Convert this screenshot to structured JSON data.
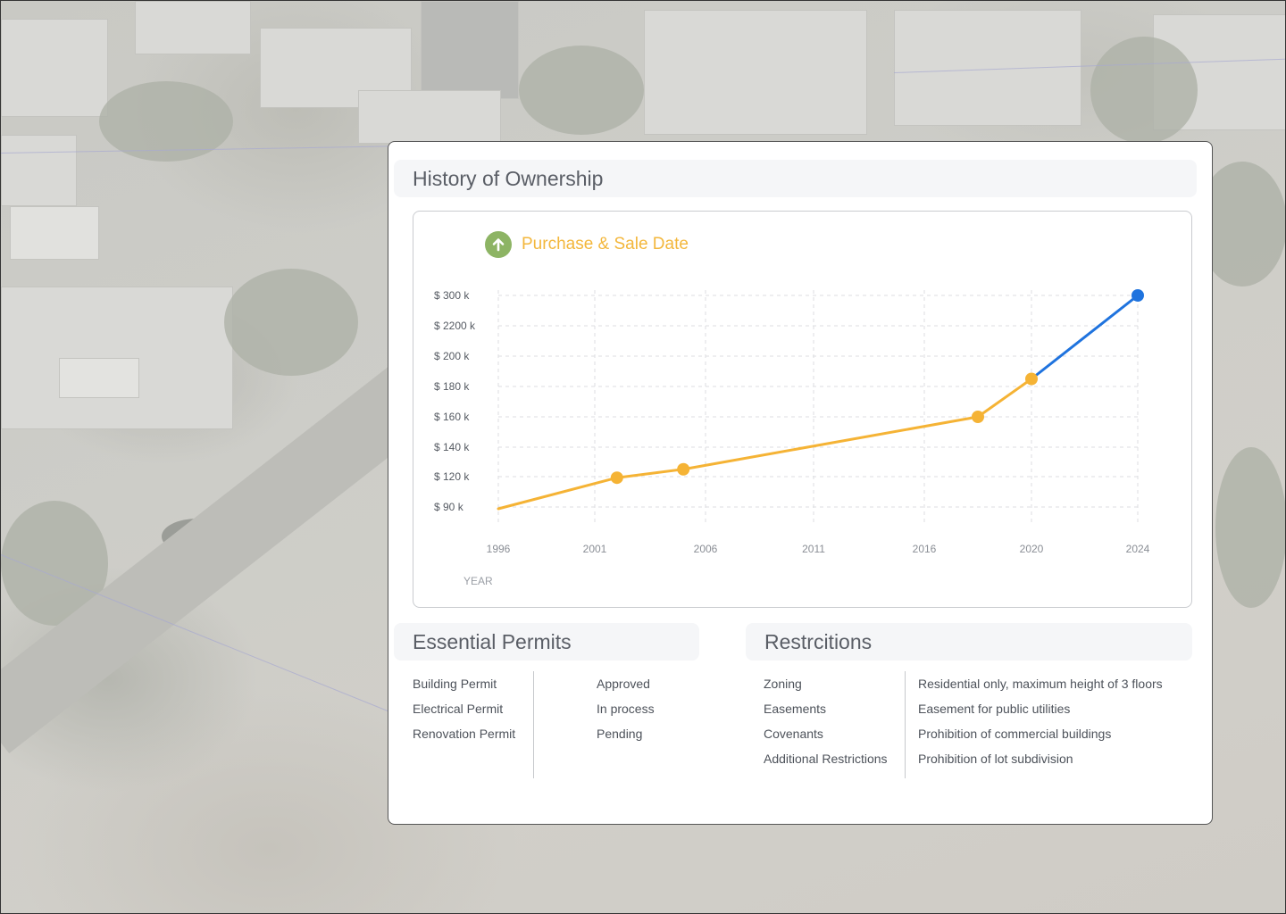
{
  "ownership": {
    "title": "History of Ownership"
  },
  "chart": {
    "icon": "arrow-up-circle-icon",
    "title": "Purchase & Sale Date",
    "colors": {
      "history": "#f5b335",
      "projection": "#1f73de",
      "icon_bg": "#8db464",
      "title": "#f3b73c"
    }
  },
  "chart_data": {
    "type": "line",
    "title": "Purchase & Sale Date",
    "xlabel": "YEAR",
    "ylabel": "",
    "x_ticks": [
      "1996",
      "2001",
      "2006",
      "2011",
      "2016",
      "2020",
      "2024"
    ],
    "y_ticks": [
      "$ 300 k",
      "$ 2200 k",
      "$ 200 k",
      "$ 180 k",
      "$ 160 k",
      "$ 140 k",
      "$ 120 k",
      "$ 90 k"
    ],
    "grid": true,
    "series": [
      {
        "color": "#f5b335",
        "points": [
          {
            "x": 1996,
            "y": 90,
            "marker": false
          },
          {
            "x": 2002,
            "y": 119,
            "marker": true
          },
          {
            "x": 2005,
            "y": 125,
            "marker": true
          },
          {
            "x": 2018,
            "y": 160,
            "marker": true
          },
          {
            "x": 2020,
            "y": 185,
            "marker": true
          }
        ]
      },
      {
        "color": "#1f73de",
        "points": [
          {
            "x": 2020,
            "y": 185,
            "marker": false
          },
          {
            "x": 2024,
            "y": 300,
            "marker": true
          }
        ]
      }
    ]
  },
  "permits": {
    "title": "Essential Permits",
    "items": [
      {
        "name": "Building Permit",
        "status": "Approved"
      },
      {
        "name": "Electrical Permit",
        "status": "In process"
      },
      {
        "name": "Renovation Permit",
        "status": "Pending"
      }
    ]
  },
  "restrictions": {
    "title": "Restrcitions",
    "items": [
      {
        "name": "Zoning",
        "detail": "Residential only, maximum height of 3 floors"
      },
      {
        "name": "Easements",
        "detail": "Easement for public utilities"
      },
      {
        "name": "Covenants",
        "detail": "Prohibition of commercial buildings"
      },
      {
        "name": "Additional Restrictions",
        "detail": "Prohibition of lot subdivision"
      }
    ]
  }
}
